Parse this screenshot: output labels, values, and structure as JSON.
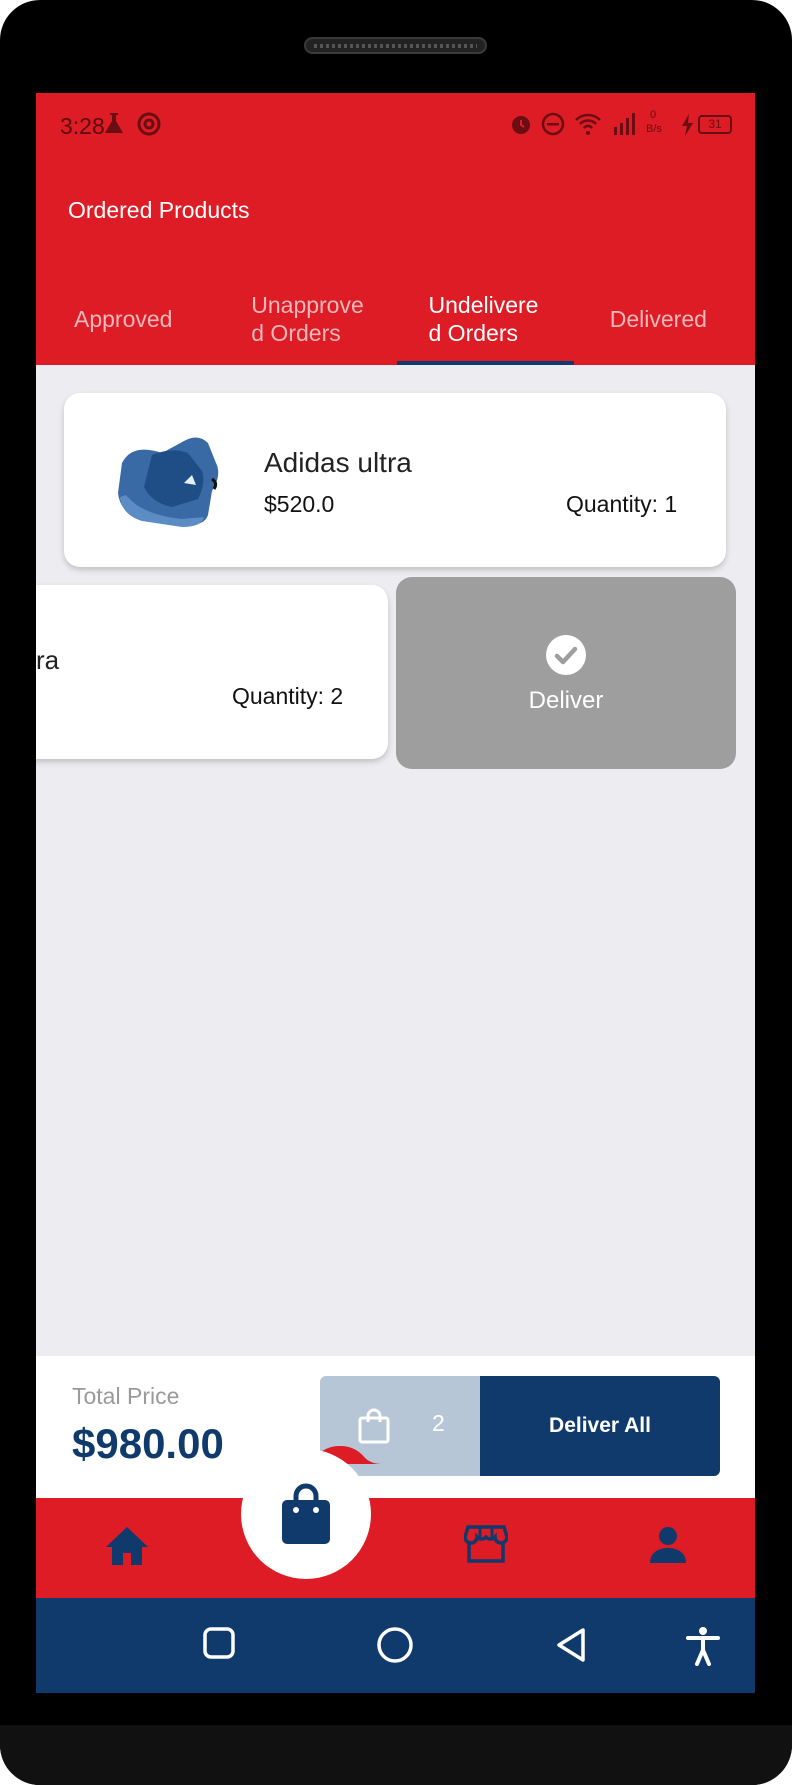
{
  "status_bar": {
    "time": "3:28",
    "battery": "31",
    "net_speed_top": "0",
    "net_speed_bottom": "B/s"
  },
  "header": {
    "title": "Ordered Products"
  },
  "tabs": [
    {
      "label": "Approved"
    },
    {
      "label": "Unapprove d Orders"
    },
    {
      "label": "Undelivere d Orders",
      "active": true
    },
    {
      "label": "Delivered"
    }
  ],
  "orders": [
    {
      "name": "Adidas ultra",
      "price": "$520.0",
      "quantity": "Quantity: 1"
    },
    {
      "name_visible": "ra",
      "quantity": "Quantity: 2"
    }
  ],
  "swipe_action": {
    "label": "Deliver"
  },
  "summary": {
    "total_label": "Total Price",
    "total_value": "$980.00",
    "bag_count": "2",
    "deliver_all_label": "Deliver All"
  },
  "colors": {
    "primary_red": "#dd1c25",
    "navy": "#0f3a6b",
    "swipe_gray": "#9e9e9e",
    "background": "#ececf1"
  },
  "icons": {
    "nav": [
      "home-icon",
      "shopping-bag-icon",
      "store-icon",
      "person-icon"
    ],
    "system": [
      "square-recents-icon",
      "circle-home-icon",
      "triangle-back-icon",
      "accessibility-icon"
    ]
  }
}
